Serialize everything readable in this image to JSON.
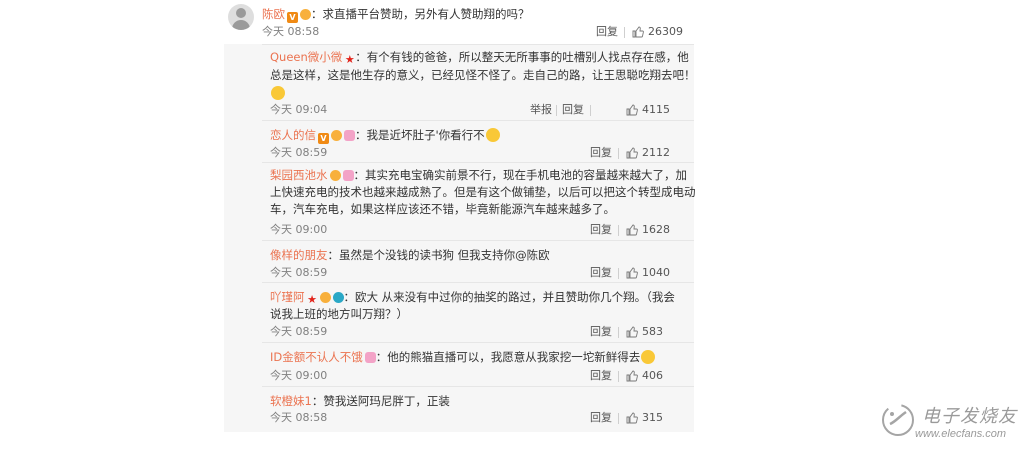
{
  "main_comment": {
    "username": "陈欧",
    "text": "：求直播平台赞助，另外有人赞助翔的吗？",
    "time": "今天 08:58",
    "reply_label": "回复",
    "likes": "26309"
  },
  "replies": [
    {
      "username": "Queen微小微",
      "lines": [
        "：有个有钱的爸爸，所以整天无所事事的吐槽别人找点存在感，他",
        "总是这样，这是他生存的意义，已经见怪不怪了。走自己的路，让王思聪吃翔去吧！"
      ],
      "time": "今天 09:04",
      "report_label": "举报",
      "reply_label": "回复",
      "likes": "4115"
    },
    {
      "username": "恋人的信",
      "lines": [
        "：我是近坏肚子'你看行不"
      ],
      "time": "今天 08:59",
      "reply_label": "回复",
      "likes": "2112"
    },
    {
      "username": "梨园西池水",
      "lines": [
        "：其实充电宝确实前景不行，现在手机电池的容量越来越大了，加",
        "上快速充电的技术也越来越成熟了。但是有这个做铺垫，以后可以把这个转型成电动",
        "车，汽车充电，如果这样应该还不错，毕竟新能源汽车越来越多了。"
      ],
      "time": "今天 09:00",
      "reply_label": "回复",
      "likes": "1628"
    },
    {
      "username": "像样的朋友",
      "lines": [
        "：虽然是个没钱的读书狗 但我支持你@陈欧"
      ],
      "time": "今天 08:59",
      "reply_label": "回复",
      "likes": "1040"
    },
    {
      "username": "吖瑾阿",
      "lines": [
        "：欧大 从来没有中过你的抽奖的路过，并且赞助你几个翔。（我会",
        "说我上班的地方叫万翔？）"
      ],
      "time": "今天 08:59",
      "reply_label": "回复",
      "likes": "583"
    },
    {
      "username": "ID金额不认人不饿",
      "lines": [
        "：他的熊猫直播可以，我愿意从我家挖一坨新鲜得去"
      ],
      "time": "今天 09:00",
      "reply_label": "回复",
      "likes": "406"
    },
    {
      "username": "软橙妹1",
      "lines": [
        "：赞我送阿玛尼胖丁，正装"
      ],
      "time": "今天 08:58",
      "reply_label": "回复",
      "likes": "315"
    }
  ],
  "badges": {
    "v": "V",
    "star": "★"
  },
  "watermark": {
    "title": "电子发烧友",
    "url": "www.elecfans.com"
  },
  "colors": {
    "username": "#eb7350",
    "reply_name": "#eb7350",
    "background": "#f6f6f6"
  }
}
